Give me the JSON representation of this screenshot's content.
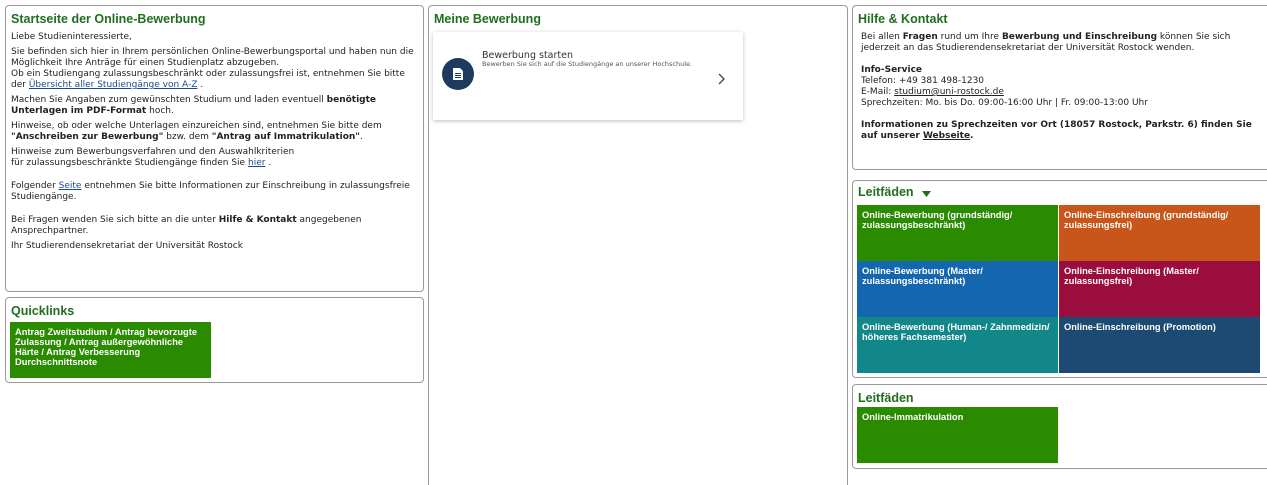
{
  "start": {
    "title": "Startseite der Online-Bewerbung",
    "greeting": "Liebe Studieninteressierte,",
    "p1": "Sie befinden sich hier in Ihrem persönlichen Online-Bewerbungsportal und haben nun die Möglichkeit Ihre Anträge für einen Studienplatz abzugeben.",
    "p2": "Ob ein Studiengang zulassungsbeschränkt oder zulassungsfrei ist, entnehmen Sie bitte der",
    "p2_link": "Übersicht aller Studiengänge von A-Z",
    "p2_end": ".",
    "p3": "Machen Sie Angaben zum gewünschten Studium und laden eventuell",
    "p3_bold": "benötigte Unterlagen im PDF-Format",
    "p3_end": "hoch.",
    "p4": "Hinweise, ob oder welche Unterlagen einzureichen sind, entnehmen Sie bitte dem",
    "p4_bold1": "\"Anschreiben zur Bewerbung\"",
    "p4_mid": "bzw. dem",
    "p4_bold2": "\"Antrag auf Immatrikulation\"",
    "p4_end": ".",
    "p5a": "Hinweise zum Bewerbungsverfahren und den Auswahlkriterien",
    "p5b": "für zulassungsbeschränkte Studiengänge finden Sie",
    "p5_link": "hier",
    "p5_end": ".",
    "p6": "Folgender",
    "p6_link": "Seite",
    "p6_end": "entnehmen Sie bitte Informationen zur Einschreibung in zulassungsfreie Studiengänge.",
    "p7": "Bei Fragen wenden Sie sich bitte an die unter",
    "p7_bold": "Hilfe & Kontakt",
    "p7_end": "angegebenen Ansprechpartner.",
    "p8": "Ihr Studierendensekretariat der Universität Rostock"
  },
  "quicklinks": {
    "title": "Quicklinks",
    "tile": "Antrag Zweitstudium / Antrag bevorzugte Zulassung / Antrag außergewöhnliche Härte / Antrag Verbesserung Durchschnittsnote",
    "tile_color": "#2a8a00"
  },
  "bewerbung": {
    "title": "Meine Bewerbung",
    "card_title": "Bewerbung starten",
    "card_sub": "Bewerben Sie sich auf die Studiengänge an unserer Hochschule."
  },
  "hilfe": {
    "title": "Hilfe & Kontakt",
    "intro_a": "Bei allen",
    "intro_bold": "Fragen",
    "intro_b": "rund um Ihre",
    "intro_bold2": "Bewerbung und Einschreibung",
    "intro_c": "können Sie sich jederzeit an das Studierendensekretariat der Universität Rostock wenden.",
    "info_title": "Info-Service",
    "phone": "Telefon: +49 381 498-1230",
    "email_label": "E-Mail:",
    "email": "studium@uni-rostock.de",
    "hours": "Sprechzeiten: Mo. bis Do. 09:00-16:00 Uhr | Fr. 09:00-13:00 Uhr",
    "onsite": "Informationen zu Sprechzeiten vor Ort (18057 Rostock, Parkstr. 6) finden Sie auf unserer",
    "onsite_link": "Webseite",
    "onsite_end": "."
  },
  "leitfaeden": {
    "title": "Leitfäden",
    "tiles": [
      {
        "label": "Online-Bewerbung (grundständig/ zulassungsbeschränkt)",
        "color": "#2a8a00"
      },
      {
        "label": "Online-Einschreibung (grundständig/ zulassungsfrei)",
        "color": "#c8551a"
      },
      {
        "label": "Online-Bewerbung (Master/ zulassungsbeschränkt)",
        "color": "#1467ae"
      },
      {
        "label": "Online-Einschreibung (Master/ zulassungsfrei)",
        "color": "#9b0d3c"
      },
      {
        "label": "Online-Bewerbung (Human-/ Zahnmedizin/ höheres Fachsemester)",
        "color": "#12878a"
      },
      {
        "label": "Online-Einschreibung (Promotion)",
        "color": "#1c4a73"
      }
    ]
  },
  "leitfaeden2": {
    "title": "Leitfäden",
    "tile": "Online-Immatrikulation",
    "tile_color": "#2a8a00"
  },
  "icons": {
    "card": "document-icon",
    "chevron": "chevron-right-icon",
    "dropdown": "chevron-down-icon"
  }
}
